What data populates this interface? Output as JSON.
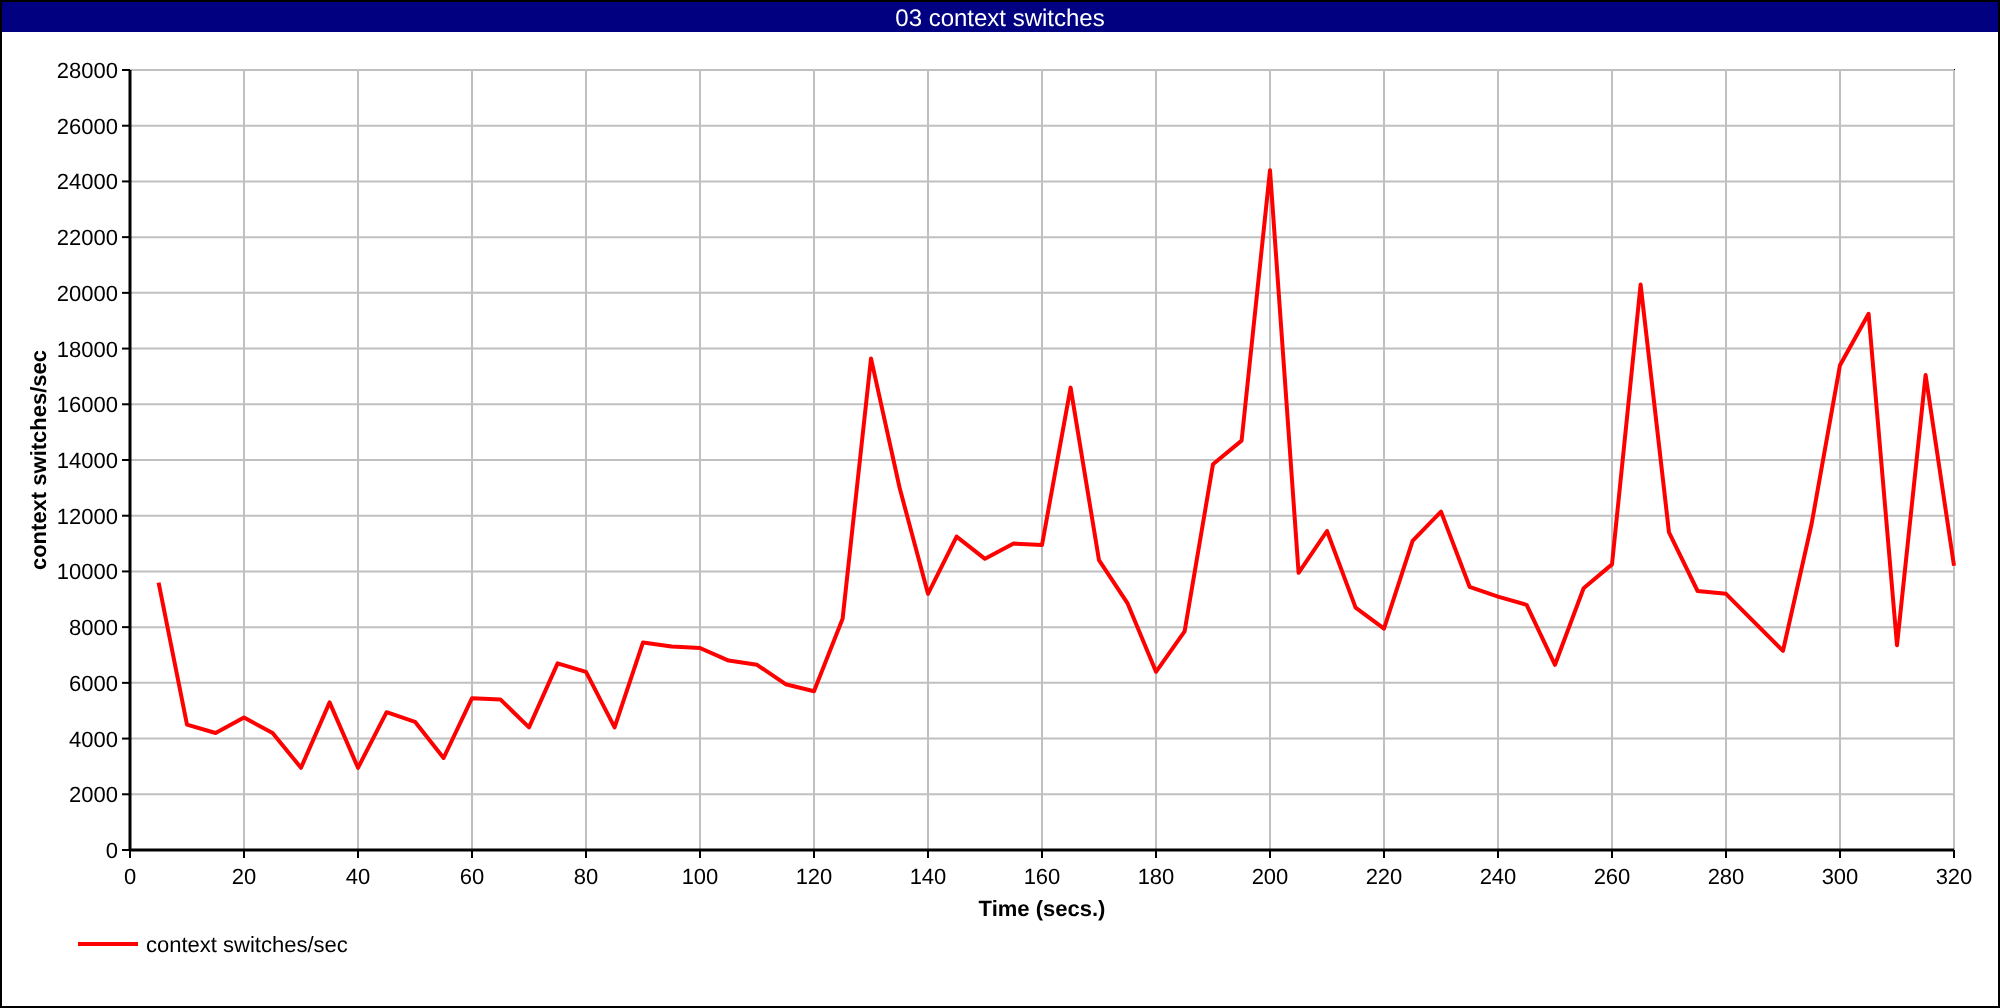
{
  "window": {
    "title": "03 context switches"
  },
  "chart_data": {
    "type": "line",
    "xlabel": "Time (secs.)",
    "ylabel": "context switches/sec",
    "x": [
      5,
      10,
      15,
      20,
      25,
      30,
      35,
      40,
      45,
      50,
      55,
      60,
      65,
      70,
      75,
      80,
      85,
      90,
      95,
      100,
      105,
      110,
      115,
      120,
      125,
      130,
      135,
      140,
      145,
      150,
      155,
      160,
      165,
      170,
      175,
      180,
      185,
      190,
      195,
      200,
      205,
      210,
      215,
      220,
      225,
      230,
      235,
      240,
      245,
      250,
      255,
      260,
      265,
      270,
      275,
      280,
      290,
      295,
      300,
      305,
      310,
      315,
      320
    ],
    "series": [
      {
        "name": "context switches/sec",
        "color": "#ff0000",
        "values": [
          9600,
          4500,
          4200,
          4750,
          4200,
          2950,
          5300,
          2950,
          4950,
          4600,
          3300,
          5450,
          5400,
          4400,
          6700,
          6400,
          4400,
          7450,
          7300,
          7250,
          6800,
          6650,
          5950,
          5700,
          8300,
          17650,
          13000,
          9200,
          11250,
          10450,
          11000,
          10950,
          16600,
          10400,
          8850,
          6400,
          7850,
          13850,
          14700,
          24400,
          9950,
          11450,
          8700,
          7950,
          11100,
          12150,
          9450,
          9100,
          8800,
          6650,
          9400,
          10250,
          20300,
          11400,
          9300,
          9200,
          7150,
          11700,
          17400,
          19250,
          7350,
          17050,
          10200
        ]
      }
    ],
    "grid": true,
    "xlim": [
      0,
      320
    ],
    "ylim": [
      0,
      28000
    ],
    "xticks": [
      0,
      20,
      40,
      60,
      80,
      100,
      120,
      140,
      160,
      180,
      200,
      220,
      240,
      260,
      280,
      300,
      320
    ],
    "yticks": [
      0,
      2000,
      4000,
      6000,
      8000,
      10000,
      12000,
      14000,
      16000,
      18000,
      20000,
      22000,
      24000,
      26000,
      28000
    ]
  }
}
